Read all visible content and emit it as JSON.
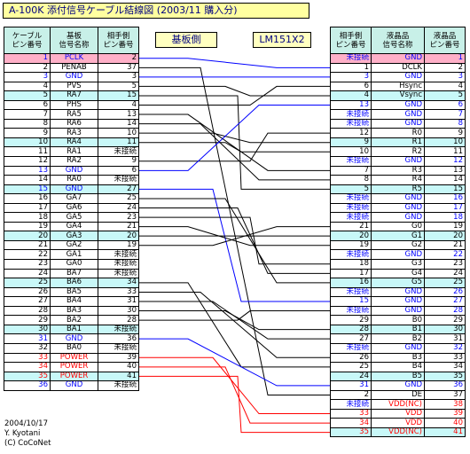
{
  "title": "A-100K 添付信号ケーブル結線図 (2003/11 購入分)",
  "callouts": {
    "board_side": "基板側",
    "lcd_side": "LM151X2"
  },
  "left_headers": [
    "ケーブル\nピン番号",
    "基板\n信号名称",
    "相手側\nピン番号"
  ],
  "right_headers": [
    "相手側\nピン番号",
    "液晶品\n信号名称",
    "液晶品\nピン番号"
  ],
  "left_rows": [
    {
      "pin": "1",
      "sig": "PCLK",
      "pair": "2",
      "hl": "pink",
      "c": "#0000ff"
    },
    {
      "pin": "2",
      "sig": "PENAB",
      "pair": "37",
      "hl": "",
      "c": "#000000"
    },
    {
      "pin": "3",
      "sig": "GND",
      "pair": "3",
      "hl": "",
      "c": "#0000ff"
    },
    {
      "pin": "4",
      "sig": "PVS",
      "pair": "5",
      "hl": "",
      "c": "#000000"
    },
    {
      "pin": "5",
      "sig": "RA7",
      "pair": "15",
      "hl": "cyan",
      "c": "#000000"
    },
    {
      "pin": "6",
      "sig": "PHS",
      "pair": "4",
      "hl": "",
      "c": "#000000"
    },
    {
      "pin": "7",
      "sig": "RA5",
      "pair": "13",
      "hl": "",
      "c": "#000000"
    },
    {
      "pin": "8",
      "sig": "RA6",
      "pair": "14",
      "hl": "",
      "c": "#000000"
    },
    {
      "pin": "9",
      "sig": "RA3",
      "pair": "10",
      "hl": "",
      "c": "#000000"
    },
    {
      "pin": "10",
      "sig": "RA4",
      "pair": "11",
      "hl": "cyan",
      "c": "#000000"
    },
    {
      "pin": "11",
      "sig": "RA1",
      "pair": "未接続",
      "hl": "",
      "c": "#000000"
    },
    {
      "pin": "12",
      "sig": "RA2",
      "pair": "9",
      "hl": "",
      "c": "#000000"
    },
    {
      "pin": "13",
      "sig": "GND",
      "pair": "6",
      "hl": "",
      "c": "#0000ff"
    },
    {
      "pin": "14",
      "sig": "RA0",
      "pair": "未接続",
      "hl": "",
      "c": "#000000"
    },
    {
      "pin": "15",
      "sig": "GND",
      "pair": "27",
      "hl": "cyan",
      "c": "#0000ff"
    },
    {
      "pin": "16",
      "sig": "GA7",
      "pair": "25",
      "hl": "",
      "c": "#000000"
    },
    {
      "pin": "17",
      "sig": "GA6",
      "pair": "24",
      "hl": "",
      "c": "#000000"
    },
    {
      "pin": "18",
      "sig": "GA5",
      "pair": "23",
      "hl": "",
      "c": "#000000"
    },
    {
      "pin": "19",
      "sig": "GA4",
      "pair": "21",
      "hl": "",
      "c": "#000000"
    },
    {
      "pin": "20",
      "sig": "GA3",
      "pair": "20",
      "hl": "cyan",
      "c": "#000000"
    },
    {
      "pin": "21",
      "sig": "GA2",
      "pair": "19",
      "hl": "",
      "c": "#000000"
    },
    {
      "pin": "22",
      "sig": "GA1",
      "pair": "未接続",
      "hl": "",
      "c": "#000000"
    },
    {
      "pin": "23",
      "sig": "GA0",
      "pair": "未接続",
      "hl": "",
      "c": "#000000"
    },
    {
      "pin": "24",
      "sig": "BA7",
      "pair": "未接続",
      "hl": "",
      "c": "#000000"
    },
    {
      "pin": "25",
      "sig": "BA6",
      "pair": "34",
      "hl": "cyan",
      "c": "#000000"
    },
    {
      "pin": "26",
      "sig": "BA5",
      "pair": "33",
      "hl": "",
      "c": "#000000"
    },
    {
      "pin": "27",
      "sig": "BA4",
      "pair": "31",
      "hl": "",
      "c": "#000000"
    },
    {
      "pin": "28",
      "sig": "BA3",
      "pair": "30",
      "hl": "",
      "c": "#000000"
    },
    {
      "pin": "29",
      "sig": "BA2",
      "pair": "28",
      "hl": "",
      "c": "#000000"
    },
    {
      "pin": "30",
      "sig": "BA1",
      "pair": "未接続",
      "hl": "cyan",
      "c": "#000000"
    },
    {
      "pin": "31",
      "sig": "GND",
      "pair": "36",
      "hl": "",
      "c": "#0000ff"
    },
    {
      "pin": "32",
      "sig": "BA0",
      "pair": "未接続",
      "hl": "",
      "c": "#000000"
    },
    {
      "pin": "33",
      "sig": "POWER",
      "pair": "39",
      "hl": "",
      "c": "#ff0000"
    },
    {
      "pin": "34",
      "sig": "POWER",
      "pair": "40",
      "hl": "",
      "c": "#ff0000"
    },
    {
      "pin": "35",
      "sig": "POWER",
      "pair": "41",
      "hl": "cyan",
      "c": "#ff0000"
    },
    {
      "pin": "36",
      "sig": "GND",
      "pair": "未接続",
      "hl": "",
      "c": "#0000ff"
    }
  ],
  "right_rows": [
    {
      "pair": "未接続",
      "sig": "GND",
      "pin": "1",
      "hl": "pink",
      "c": "#0000ff"
    },
    {
      "pair": "1",
      "sig": "DCLK",
      "pin": "2",
      "hl": "",
      "c": "#000000"
    },
    {
      "pair": "3",
      "sig": "GND",
      "pin": "3",
      "hl": "",
      "c": "#0000ff"
    },
    {
      "pair": "6",
      "sig": "Hsync",
      "pin": "4",
      "hl": "",
      "c": "#000000"
    },
    {
      "pair": "4",
      "sig": "Vsync",
      "pin": "5",
      "hl": "cyan",
      "c": "#000000"
    },
    {
      "pair": "13",
      "sig": "GND",
      "pin": "6",
      "hl": "",
      "c": "#0000ff"
    },
    {
      "pair": "未接続",
      "sig": "GND",
      "pin": "7",
      "hl": "",
      "c": "#0000ff"
    },
    {
      "pair": "未接続",
      "sig": "GND",
      "pin": "8",
      "hl": "",
      "c": "#0000ff"
    },
    {
      "pair": "12",
      "sig": "R0",
      "pin": "9",
      "hl": "",
      "c": "#000000"
    },
    {
      "pair": "9",
      "sig": "R1",
      "pin": "10",
      "hl": "cyan",
      "c": "#000000"
    },
    {
      "pair": "10",
      "sig": "R2",
      "pin": "11",
      "hl": "",
      "c": "#000000"
    },
    {
      "pair": "未接続",
      "sig": "GND",
      "pin": "12",
      "hl": "",
      "c": "#0000ff"
    },
    {
      "pair": "7",
      "sig": "R3",
      "pin": "13",
      "hl": "",
      "c": "#000000"
    },
    {
      "pair": "8",
      "sig": "R4",
      "pin": "14",
      "hl": "",
      "c": "#000000"
    },
    {
      "pair": "5",
      "sig": "R5",
      "pin": "15",
      "hl": "cyan",
      "c": "#000000"
    },
    {
      "pair": "未接続",
      "sig": "GND",
      "pin": "16",
      "hl": "",
      "c": "#0000ff"
    },
    {
      "pair": "未接続",
      "sig": "GND",
      "pin": "17",
      "hl": "",
      "c": "#0000ff"
    },
    {
      "pair": "未接続",
      "sig": "GND",
      "pin": "18",
      "hl": "",
      "c": "#0000ff"
    },
    {
      "pair": "21",
      "sig": "G0",
      "pin": "19",
      "hl": "",
      "c": "#000000"
    },
    {
      "pair": "20",
      "sig": "G1",
      "pin": "20",
      "hl": "cyan",
      "c": "#000000"
    },
    {
      "pair": "19",
      "sig": "G2",
      "pin": "21",
      "hl": "",
      "c": "#000000"
    },
    {
      "pair": "未接続",
      "sig": "GND",
      "pin": "22",
      "hl": "",
      "c": "#0000ff"
    },
    {
      "pair": "18",
      "sig": "G3",
      "pin": "23",
      "hl": "",
      "c": "#000000"
    },
    {
      "pair": "17",
      "sig": "G4",
      "pin": "24",
      "hl": "",
      "c": "#000000"
    },
    {
      "pair": "16",
      "sig": "G5",
      "pin": "25",
      "hl": "cyan",
      "c": "#000000"
    },
    {
      "pair": "未接続",
      "sig": "GND",
      "pin": "26",
      "hl": "",
      "c": "#0000ff"
    },
    {
      "pair": "15",
      "sig": "GND",
      "pin": "27",
      "hl": "",
      "c": "#0000ff"
    },
    {
      "pair": "未接続",
      "sig": "GND",
      "pin": "28",
      "hl": "",
      "c": "#0000ff"
    },
    {
      "pair": "29",
      "sig": "B0",
      "pin": "29",
      "hl": "",
      "c": "#000000"
    },
    {
      "pair": "28",
      "sig": "B1",
      "pin": "30",
      "hl": "cyan",
      "c": "#000000"
    },
    {
      "pair": "27",
      "sig": "B2",
      "pin": "31",
      "hl": "",
      "c": "#000000"
    },
    {
      "pair": "未接続",
      "sig": "GND",
      "pin": "32",
      "hl": "",
      "c": "#0000ff"
    },
    {
      "pair": "26",
      "sig": "B3",
      "pin": "33",
      "hl": "",
      "c": "#000000"
    },
    {
      "pair": "25",
      "sig": "B4",
      "pin": "34",
      "hl": "",
      "c": "#000000"
    },
    {
      "pair": "24",
      "sig": "B5",
      "pin": "35",
      "hl": "cyan",
      "c": "#000000"
    },
    {
      "pair": "31",
      "sig": "GND",
      "pin": "36",
      "hl": "",
      "c": "#0000ff"
    },
    {
      "pair": "2",
      "sig": "DE",
      "pin": "37",
      "hl": "",
      "c": "#000000"
    },
    {
      "pair": "未接続",
      "sig": "VDD(NC)",
      "pin": "38",
      "hl": "",
      "c": "#ff0000"
    },
    {
      "pair": "33",
      "sig": "VDD",
      "pin": "39",
      "hl": "",
      "c": "#ff0000"
    },
    {
      "pair": "34",
      "sig": "VDD",
      "pin": "40",
      "hl": "",
      "c": "#ff0000"
    },
    {
      "pair": "35",
      "sig": "VDD(NC)",
      "pin": "41",
      "hl": "cyan",
      "c": "#ff0000"
    }
  ],
  "footer": [
    "2004/10/17",
    "Y. Kyotani",
    "(C) CoCoNet"
  ],
  "colors": {
    "gnd": "#0000ff",
    "power": "#ff0000",
    "signal": "#000000",
    "title_bg": "#ffffa0",
    "header_bg": "#c8f0e8",
    "pin1_highlight": "#ffb0c8",
    "row5_highlight": "#c8f8f8"
  }
}
